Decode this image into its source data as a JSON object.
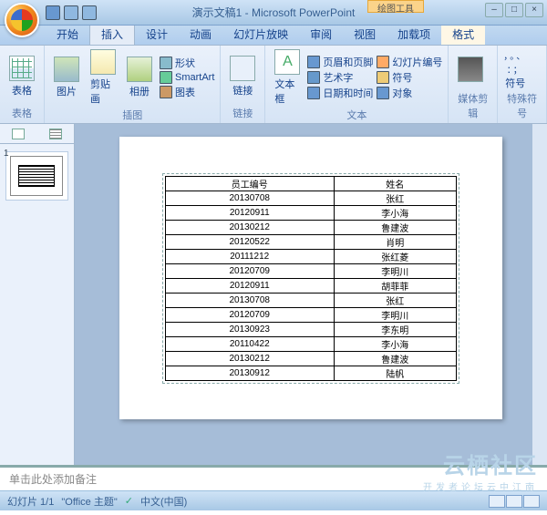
{
  "title": "演示文稿1 - Microsoft PowerPoint",
  "context_tab": "绘图工具",
  "tabs": {
    "home": "开始",
    "insert": "插入",
    "design": "设计",
    "anim": "动画",
    "show": "幻灯片放映",
    "review": "审阅",
    "view": "视图",
    "addin": "加载项",
    "format": "格式"
  },
  "ribbon": {
    "g_table": "表格",
    "b_table": "表格",
    "g_illus": "插图",
    "b_pic": "图片",
    "b_clip": "剪贴画",
    "b_album": "相册",
    "b_shape": "形状",
    "b_smartart": "SmartArt",
    "b_chart": "图表",
    "g_link": "链接",
    "b_link": "链接",
    "g_text": "文本",
    "b_textbox": "文本框",
    "b_header": "页眉和页脚",
    "b_wordart": "艺术字",
    "b_date": "日期和时间",
    "b_slidenum": "幻灯片编号",
    "b_symbol": "符号",
    "b_object": "对象",
    "g_media": "媒体剪辑",
    "g_sym": "特殊符号",
    "b_symdrop": "符号"
  },
  "table": {
    "headers": [
      "员工编号",
      "姓名"
    ],
    "rows": [
      [
        "20130708",
        "张红"
      ],
      [
        "20120911",
        "李小海"
      ],
      [
        "20130212",
        "鲁建波"
      ],
      [
        "20120522",
        "肖明"
      ],
      [
        "20111212",
        "张红菱"
      ],
      [
        "20120709",
        "李明川"
      ],
      [
        "20120911",
        "胡菲菲"
      ],
      [
        "20130708",
        "张红"
      ],
      [
        "20120709",
        "李明川"
      ],
      [
        "20130923",
        "李东明"
      ],
      [
        "20110422",
        "李小海"
      ],
      [
        "20130212",
        "鲁建波"
      ],
      [
        "20130912",
        "陆帆"
      ]
    ]
  },
  "notes_placeholder": "单击此处添加备注",
  "status": {
    "slide": "幻灯片 1/1",
    "theme": "\"Office 主题\"",
    "lang": "中文(中国)"
  },
  "slidenum": "1",
  "watermark": {
    "l1": "云栖社区",
    "l2": "开发者论坛云中江南"
  },
  "symbols": {
    "r1": "，。、",
    "r2": "：；"
  }
}
